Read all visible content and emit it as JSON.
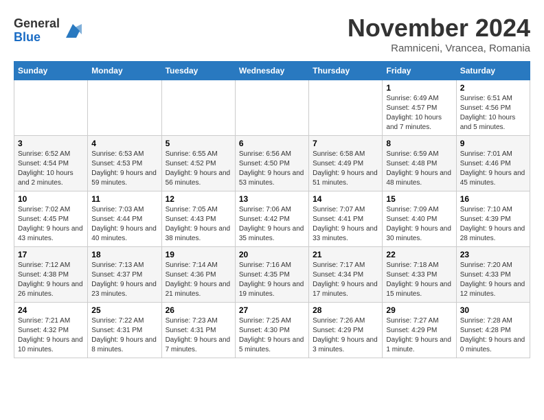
{
  "header": {
    "logo_line1": "General",
    "logo_line2": "Blue",
    "title": "November 2024",
    "subtitle": "Ramniceni, Vrancea, Romania"
  },
  "weekdays": [
    "Sunday",
    "Monday",
    "Tuesday",
    "Wednesday",
    "Thursday",
    "Friday",
    "Saturday"
  ],
  "weeks": [
    [
      {
        "day": "",
        "info": ""
      },
      {
        "day": "",
        "info": ""
      },
      {
        "day": "",
        "info": ""
      },
      {
        "day": "",
        "info": ""
      },
      {
        "day": "",
        "info": ""
      },
      {
        "day": "1",
        "info": "Sunrise: 6:49 AM\nSunset: 4:57 PM\nDaylight: 10 hours and 7 minutes."
      },
      {
        "day": "2",
        "info": "Sunrise: 6:51 AM\nSunset: 4:56 PM\nDaylight: 10 hours and 5 minutes."
      }
    ],
    [
      {
        "day": "3",
        "info": "Sunrise: 6:52 AM\nSunset: 4:54 PM\nDaylight: 10 hours and 2 minutes."
      },
      {
        "day": "4",
        "info": "Sunrise: 6:53 AM\nSunset: 4:53 PM\nDaylight: 9 hours and 59 minutes."
      },
      {
        "day": "5",
        "info": "Sunrise: 6:55 AM\nSunset: 4:52 PM\nDaylight: 9 hours and 56 minutes."
      },
      {
        "day": "6",
        "info": "Sunrise: 6:56 AM\nSunset: 4:50 PM\nDaylight: 9 hours and 53 minutes."
      },
      {
        "day": "7",
        "info": "Sunrise: 6:58 AM\nSunset: 4:49 PM\nDaylight: 9 hours and 51 minutes."
      },
      {
        "day": "8",
        "info": "Sunrise: 6:59 AM\nSunset: 4:48 PM\nDaylight: 9 hours and 48 minutes."
      },
      {
        "day": "9",
        "info": "Sunrise: 7:01 AM\nSunset: 4:46 PM\nDaylight: 9 hours and 45 minutes."
      }
    ],
    [
      {
        "day": "10",
        "info": "Sunrise: 7:02 AM\nSunset: 4:45 PM\nDaylight: 9 hours and 43 minutes."
      },
      {
        "day": "11",
        "info": "Sunrise: 7:03 AM\nSunset: 4:44 PM\nDaylight: 9 hours and 40 minutes."
      },
      {
        "day": "12",
        "info": "Sunrise: 7:05 AM\nSunset: 4:43 PM\nDaylight: 9 hours and 38 minutes."
      },
      {
        "day": "13",
        "info": "Sunrise: 7:06 AM\nSunset: 4:42 PM\nDaylight: 9 hours and 35 minutes."
      },
      {
        "day": "14",
        "info": "Sunrise: 7:07 AM\nSunset: 4:41 PM\nDaylight: 9 hours and 33 minutes."
      },
      {
        "day": "15",
        "info": "Sunrise: 7:09 AM\nSunset: 4:40 PM\nDaylight: 9 hours and 30 minutes."
      },
      {
        "day": "16",
        "info": "Sunrise: 7:10 AM\nSunset: 4:39 PM\nDaylight: 9 hours and 28 minutes."
      }
    ],
    [
      {
        "day": "17",
        "info": "Sunrise: 7:12 AM\nSunset: 4:38 PM\nDaylight: 9 hours and 26 minutes."
      },
      {
        "day": "18",
        "info": "Sunrise: 7:13 AM\nSunset: 4:37 PM\nDaylight: 9 hours and 23 minutes."
      },
      {
        "day": "19",
        "info": "Sunrise: 7:14 AM\nSunset: 4:36 PM\nDaylight: 9 hours and 21 minutes."
      },
      {
        "day": "20",
        "info": "Sunrise: 7:16 AM\nSunset: 4:35 PM\nDaylight: 9 hours and 19 minutes."
      },
      {
        "day": "21",
        "info": "Sunrise: 7:17 AM\nSunset: 4:34 PM\nDaylight: 9 hours and 17 minutes."
      },
      {
        "day": "22",
        "info": "Sunrise: 7:18 AM\nSunset: 4:33 PM\nDaylight: 9 hours and 15 minutes."
      },
      {
        "day": "23",
        "info": "Sunrise: 7:20 AM\nSunset: 4:33 PM\nDaylight: 9 hours and 12 minutes."
      }
    ],
    [
      {
        "day": "24",
        "info": "Sunrise: 7:21 AM\nSunset: 4:32 PM\nDaylight: 9 hours and 10 minutes."
      },
      {
        "day": "25",
        "info": "Sunrise: 7:22 AM\nSunset: 4:31 PM\nDaylight: 9 hours and 8 minutes."
      },
      {
        "day": "26",
        "info": "Sunrise: 7:23 AM\nSunset: 4:31 PM\nDaylight: 9 hours and 7 minutes."
      },
      {
        "day": "27",
        "info": "Sunrise: 7:25 AM\nSunset: 4:30 PM\nDaylight: 9 hours and 5 minutes."
      },
      {
        "day": "28",
        "info": "Sunrise: 7:26 AM\nSunset: 4:29 PM\nDaylight: 9 hours and 3 minutes."
      },
      {
        "day": "29",
        "info": "Sunrise: 7:27 AM\nSunset: 4:29 PM\nDaylight: 9 hours and 1 minute."
      },
      {
        "day": "30",
        "info": "Sunrise: 7:28 AM\nSunset: 4:28 PM\nDaylight: 9 hours and 0 minutes."
      }
    ]
  ]
}
